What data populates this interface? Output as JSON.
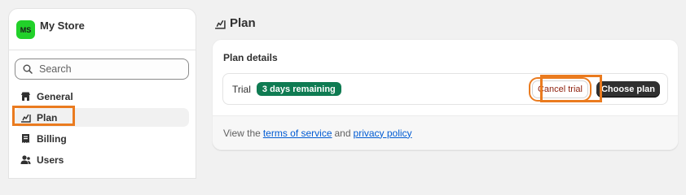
{
  "store": {
    "avatar_initials": "MS",
    "name": "My Store",
    "avatar_color": "#22d12a"
  },
  "search": {
    "placeholder": "Search",
    "value": "",
    "icon": "search-icon"
  },
  "sidebar": {
    "items": [
      {
        "label": "General",
        "icon": "store-icon",
        "active": false
      },
      {
        "label": "Plan",
        "icon": "plan-icon",
        "active": true
      },
      {
        "label": "Billing",
        "icon": "receipt-icon",
        "active": false
      },
      {
        "label": "Users",
        "icon": "users-icon",
        "active": false
      }
    ]
  },
  "page": {
    "title": "Plan",
    "title_icon": "plan-icon"
  },
  "plan_card": {
    "heading": "Plan details",
    "trial_label": "Trial",
    "trial_badge": "3 days remaining",
    "cancel_label": "Cancel trial",
    "choose_label": "Choose plan",
    "footer_prefix": "View the",
    "terms_label": "terms of service",
    "footer_and": "and",
    "privacy_label": "privacy policy"
  },
  "colors": {
    "badge": "#0f7b52",
    "highlight": "#ea7b1f",
    "cancel_text": "#8e1f0b",
    "link": "#005bd3",
    "primary_button": "#303030"
  }
}
